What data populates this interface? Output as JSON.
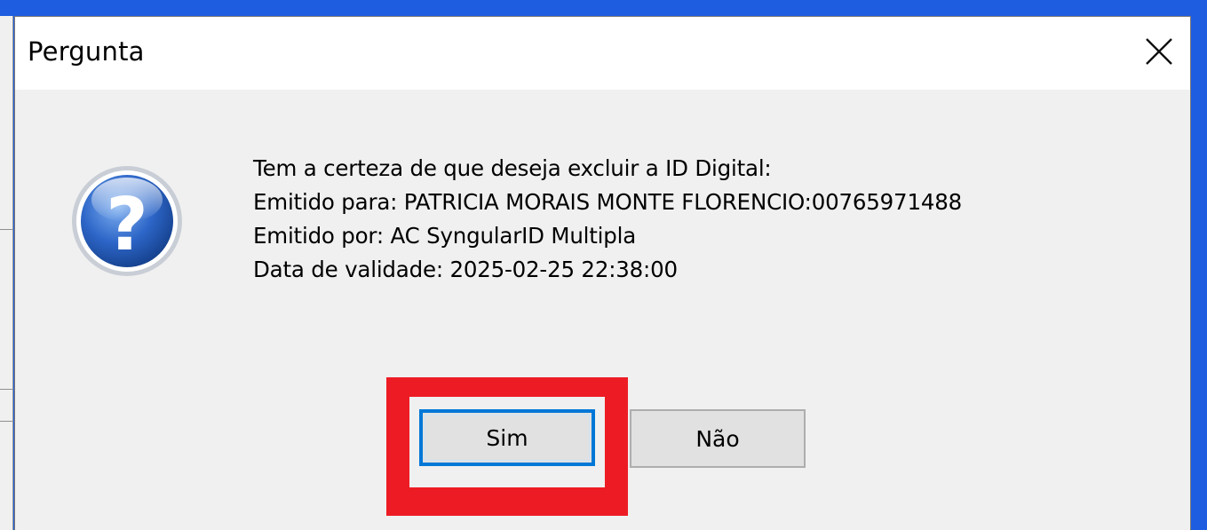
{
  "dialog": {
    "title": "Pergunta",
    "close_icon": "close-icon",
    "question_icon": "question-icon",
    "message_lines": [
      "Tem a certeza de que deseja excluir a ID Digital:",
      "Emitido para: PATRICIA MORAIS MONTE FLORENCIO:00765971488",
      "Emitido por: AC SyngularID Multipla",
      "Data de validade: 2025-02-25 22:38:00"
    ],
    "buttons": {
      "yes_label": "Sim",
      "no_label": "Não"
    }
  },
  "colors": {
    "background": "#1f5de0",
    "highlight": "#ed1c24",
    "focus_border": "#0078d7",
    "dialog_body": "#f0f0f0"
  }
}
